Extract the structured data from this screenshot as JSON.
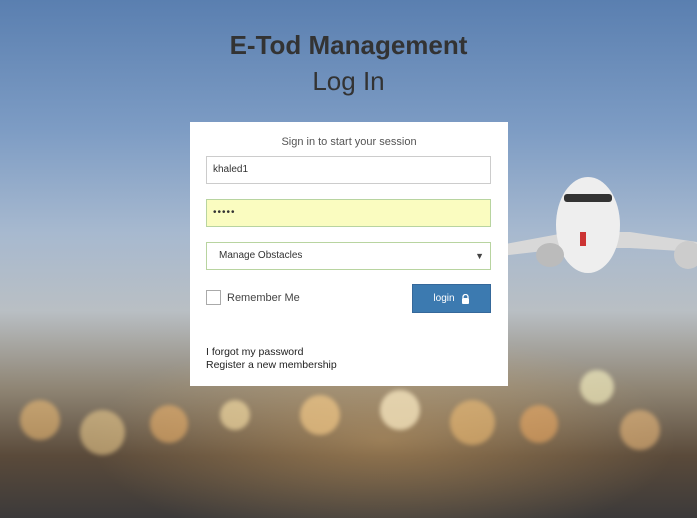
{
  "header": {
    "app_title": "E-Tod Management",
    "page_title": "Log In"
  },
  "login_box": {
    "message": "Sign in to start your session",
    "username_value": "khaled1",
    "password_mask": "•••••",
    "select_value": "Manage Obstacles",
    "remember_label": "Remember Me",
    "remember_checked": false,
    "login_label": "login",
    "forgot_link": "I forgot my password",
    "register_link": "Register a new membership"
  },
  "icons": {
    "login_button_icon": "lock-icon",
    "select_icon": "chevron-down-icon"
  },
  "colors": {
    "login_button": "#3c7ab0",
    "password_field_bg": "#fafcc0",
    "title_text": "#333333"
  }
}
